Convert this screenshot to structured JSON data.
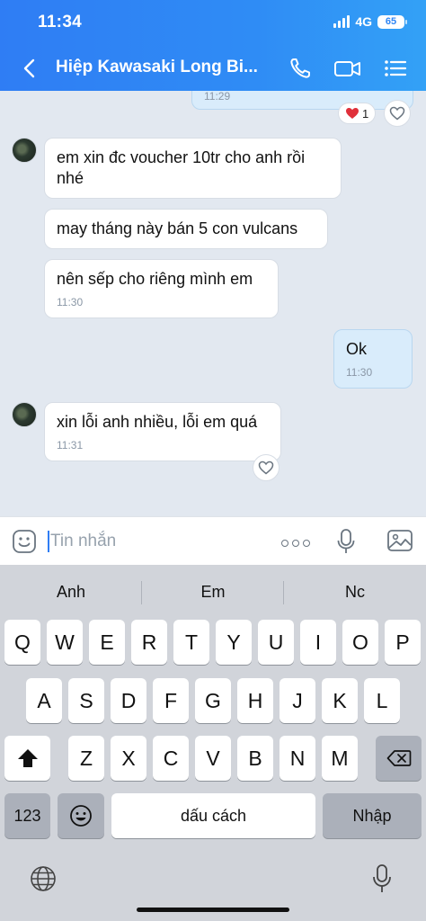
{
  "status": {
    "time": "11:34",
    "network": "4G",
    "battery": "65"
  },
  "header": {
    "title": "Hiệp Kawasaki Long Bi..."
  },
  "messages": [
    {
      "time": "11:29"
    },
    {
      "text": "em xin đc voucher 10tr cho anh rồi nhé"
    },
    {
      "text": "may tháng này bán 5 con vulcans"
    },
    {
      "text": "nên sếp cho riêng mình em",
      "time": "11:30"
    },
    {
      "text": "Ok",
      "time": "11:30"
    },
    {
      "text": "xin lỗi anh nhiều, lỗi em quá",
      "time": "11:31"
    }
  ],
  "reaction": {
    "count": "1"
  },
  "composer": {
    "placeholder": "Tin nhắn"
  },
  "keyboard": {
    "suggestions": [
      "Anh",
      "Em",
      "Nc"
    ],
    "row1": [
      "Q",
      "W",
      "E",
      "R",
      "T",
      "Y",
      "U",
      "I",
      "O",
      "P"
    ],
    "row2": [
      "A",
      "S",
      "D",
      "F",
      "G",
      "H",
      "J",
      "K",
      "L"
    ],
    "row3": [
      "Z",
      "X",
      "C",
      "V",
      "B",
      "N",
      "M"
    ],
    "numbers_label": "123",
    "space_label": "dấu cách",
    "return_label": "Nhập"
  }
}
